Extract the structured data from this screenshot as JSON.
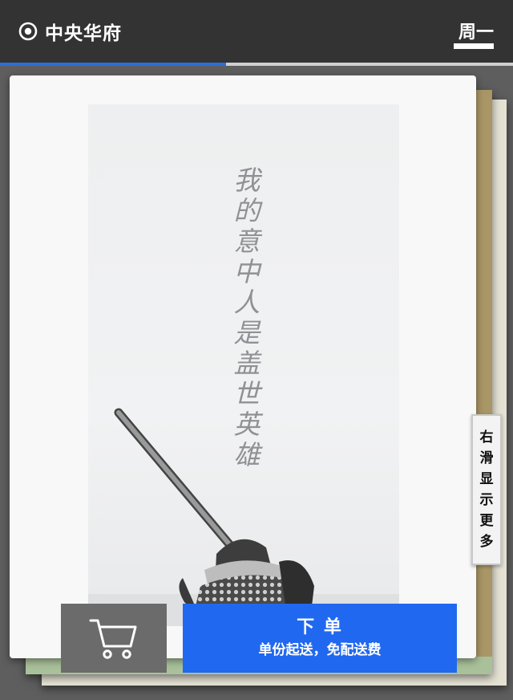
{
  "header": {
    "location_icon": "location-target-icon",
    "location": "中央华府",
    "day": "周一"
  },
  "progress": {
    "fraction": 0.44,
    "color": "#2a6fd6"
  },
  "poster": {
    "text_chars": [
      "我",
      "的",
      "意",
      "中",
      "人",
      "是",
      "盖",
      "世",
      "英",
      "雄"
    ]
  },
  "side_hint": {
    "chars": [
      "右",
      "滑",
      "显",
      "示",
      "更",
      "多"
    ]
  },
  "actions": {
    "cart_icon": "shopping-cart-icon",
    "order_label": "下 单",
    "order_sub": "单份起送，免配送费",
    "order_color": "#2168f0"
  }
}
